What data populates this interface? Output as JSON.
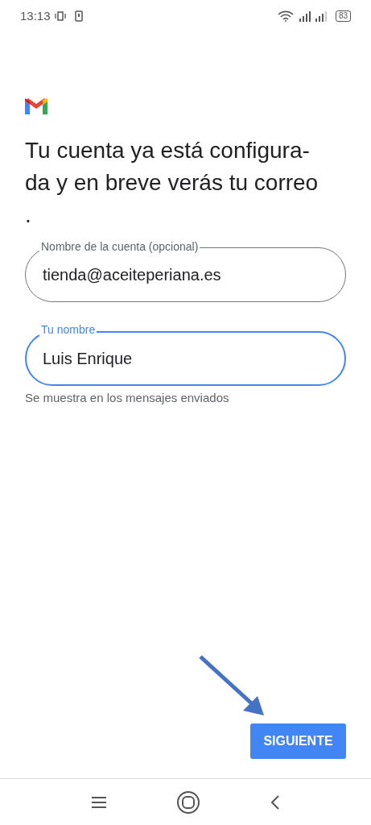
{
  "status_bar": {
    "time": "13:13",
    "battery": "83"
  },
  "heading_lines": [
    "Tu cuenta ya está configura-",
    "da y en breve verás tu correo",
    "."
  ],
  "fields": [
    {
      "label": "Nombre de la cuenta (opcional)",
      "value": "tienda@aceiteperiana.es",
      "focused": false
    },
    {
      "label": "Tu nombre",
      "value": "Luis Enrique",
      "focused": true,
      "helper": "Se muestra en los mensajes enviados"
    }
  ],
  "button": "SIGUIENTE"
}
